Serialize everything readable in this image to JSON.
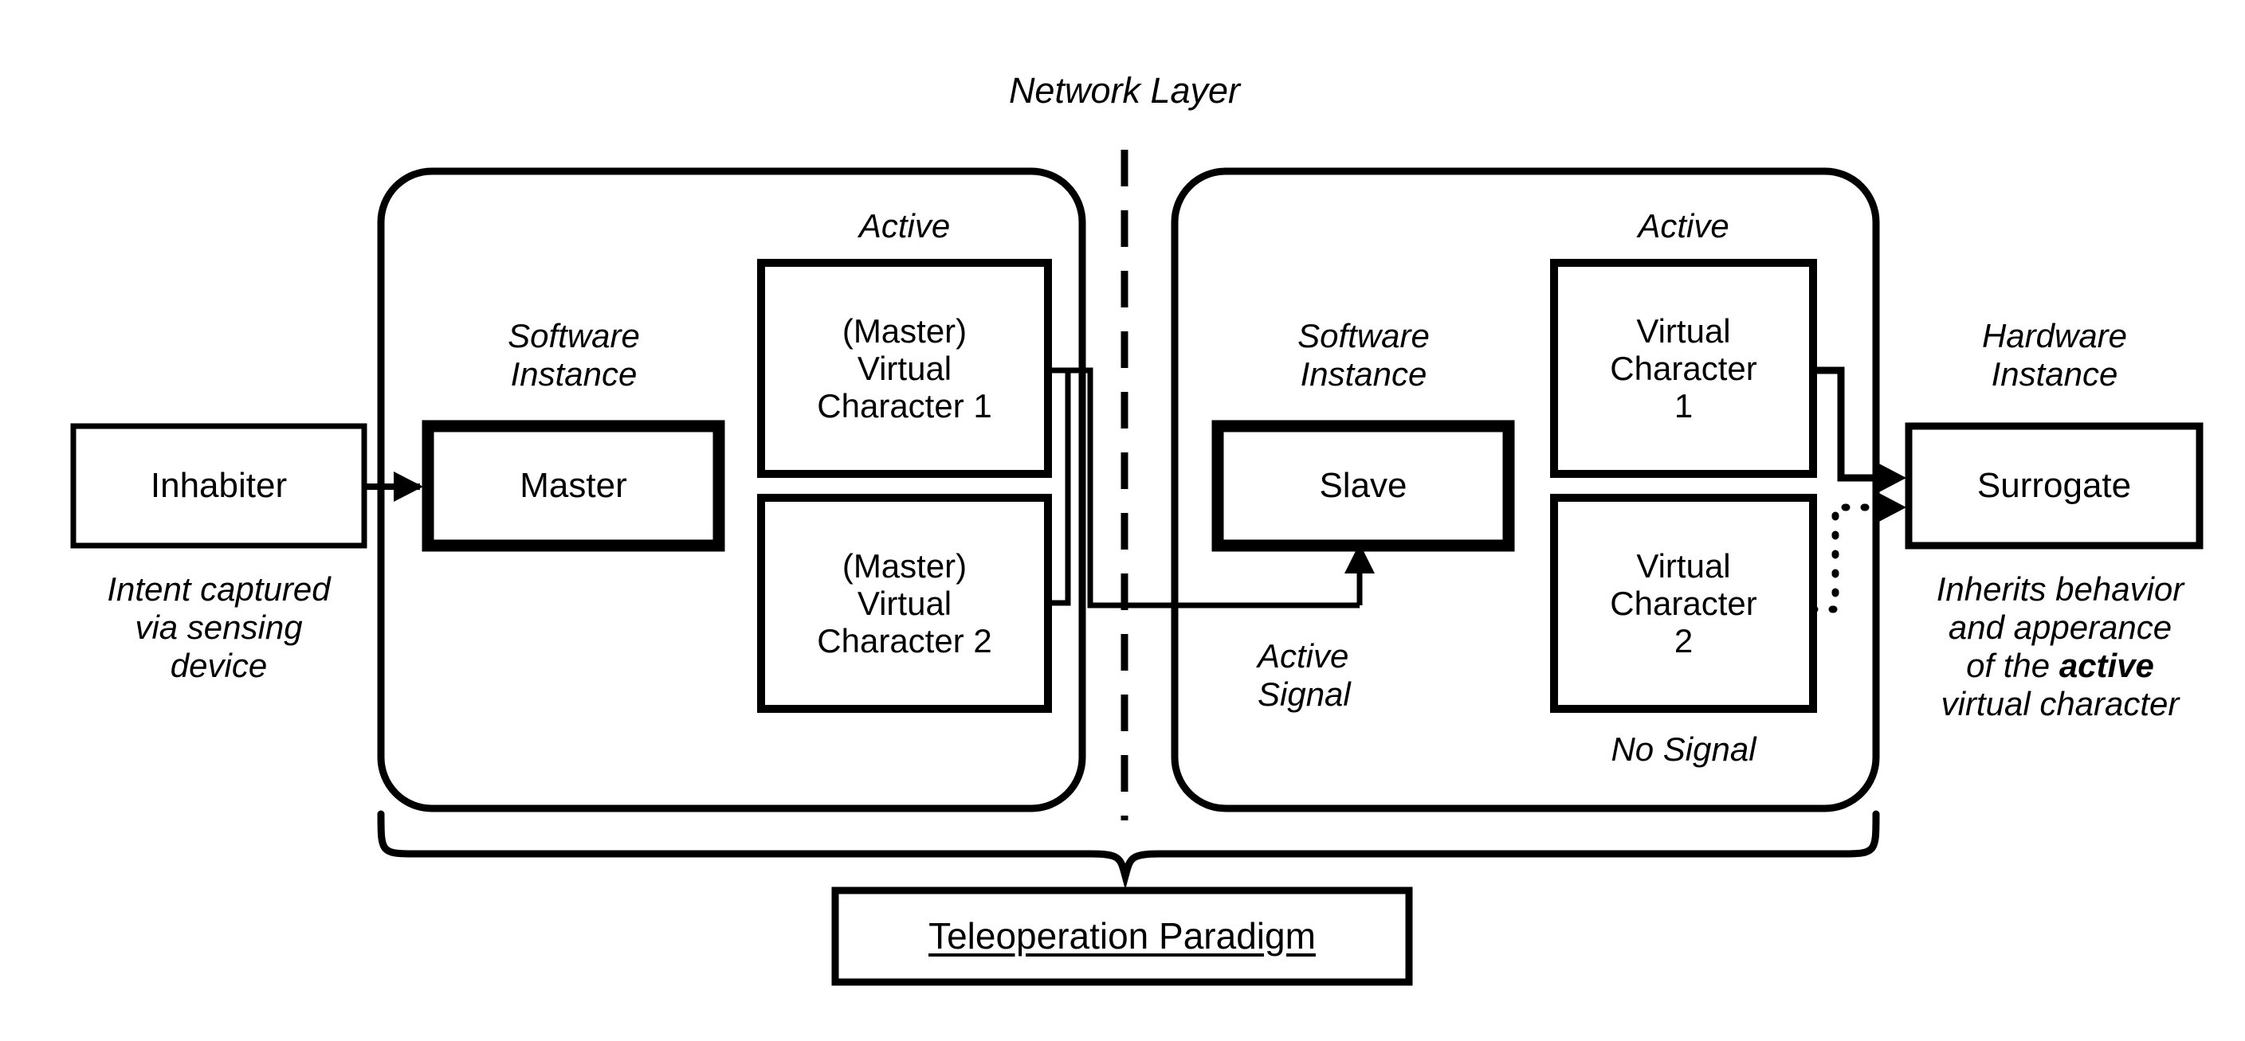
{
  "diagram": {
    "title_layer": "Network Layer",
    "bottom_label": "Teleoperation Paradigm",
    "left_side": {
      "inhabiter": {
        "label": "Inhabiter",
        "caption": "Intent captured\nvia sensing\ndevice"
      },
      "instance_caption": "Software\nInstance",
      "instance_box": "Master",
      "active_label": "Active",
      "virtual_characters": [
        {
          "label": "(Master)\nVirtual\nCharacter 1",
          "state": "Active"
        },
        {
          "label": "(Master)\nVirtual\nCharacter 2",
          "state": ""
        }
      ]
    },
    "right_side": {
      "instance_caption": "Software\nInstance",
      "instance_box": "Slave",
      "signal_in_label": "Active\nSignal",
      "active_label": "Active",
      "no_signal_label": "No Signal",
      "virtual_characters": [
        {
          "label": "Virtual\nCharacter\n1",
          "state": "Active"
        },
        {
          "label": "Virtual\nCharacter\n2",
          "state": "No Signal"
        }
      ]
    },
    "surrogate": {
      "instance_caption": "Hardware\nInstance",
      "label": "Surrogate",
      "caption_pre": "Inherits behavior\nand apperance\nof the ",
      "caption_bold": "active",
      "caption_post": "\nvirtual character"
    },
    "colors": {
      "ink": "#000000",
      "paper": "#ffffff"
    }
  }
}
